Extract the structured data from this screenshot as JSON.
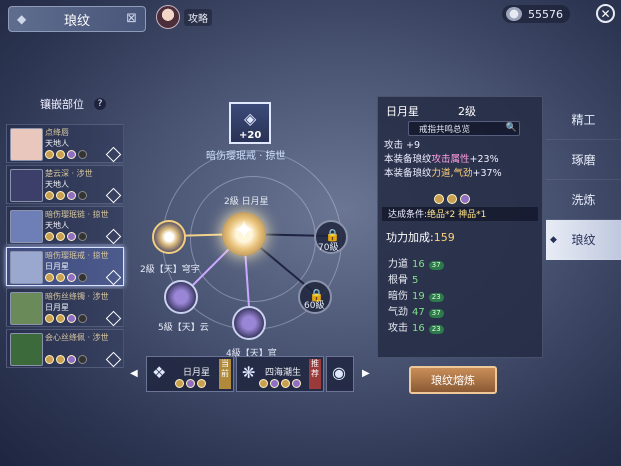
{
  "header": {
    "title": "琅纹",
    "guide_label": "攻略",
    "currency_value": "55576"
  },
  "left_panel": {
    "title": "镶嵌部位",
    "help": "?",
    "slots": [
      {
        "name": "点绛唇",
        "sub": "天地人",
        "thumb_color": "#e9c7bd",
        "selected": false
      },
      {
        "name": "楚云深 · 涉世",
        "sub": "天地人",
        "thumb_color": "#3b3f6a",
        "selected": false
      },
      {
        "name": "暗伤璎珉链 · 掠世",
        "sub": "天地人",
        "thumb_color": "#6e7fb8",
        "selected": false
      },
      {
        "name": "暗伤璎珉戒 · 掠世",
        "sub": "日月星",
        "thumb_color": "#9aa7cf",
        "selected": true
      },
      {
        "name": "暗伤丝绦镯 · 涉世",
        "sub": "日月星",
        "thumb_color": "#6a8a5a",
        "selected": false
      },
      {
        "name": "会心丝绦佩 · 涉世",
        "sub": "",
        "thumb_color": "#3d6a3a",
        "selected": false
      }
    ]
  },
  "wheel": {
    "top_gem_plus": "+20",
    "top_gem_name": "暗伤璎珉戒 · 掠世",
    "center_label": "2級 日月星",
    "nodes": [
      {
        "label": "2級【天】穹宇"
      },
      {
        "label": "5級【天】云"
      },
      {
        "label": "4級【天】官"
      },
      {
        "label": "70級"
      },
      {
        "label": "60級"
      }
    ]
  },
  "bottom_strip": {
    "cards": [
      {
        "name": "日月星",
        "tag": "当前"
      },
      {
        "name": "四海潮生",
        "tag": "推荐"
      }
    ]
  },
  "info": {
    "name": "日月星",
    "level": "2级",
    "set_button": "戒指共鸣总览",
    "stat_lines": [
      {
        "a": "攻击 +9",
        "b": "",
        "c": ""
      },
      {
        "a": "本装备琅纹",
        "b": "攻击属性",
        "c": "+23%"
      },
      {
        "a": "本装备琅纹",
        "b": "力道,气劲",
        "c": "+37%"
      }
    ],
    "condition_prefix": "达成条件:",
    "condition_value": "绝品*2 神品*1",
    "power_label": "功力加成:",
    "power_value": "159",
    "attrs": [
      {
        "name": "力道",
        "value": "16",
        "badge": "37"
      },
      {
        "name": "根骨",
        "value": "5",
        "badge": ""
      },
      {
        "name": "暗伤",
        "value": "19",
        "badge": "23"
      },
      {
        "name": "气劲",
        "value": "47",
        "badge": "37"
      },
      {
        "name": "攻击",
        "value": "16",
        "badge": "23"
      }
    ]
  },
  "forge_button": "琅纹熔炼",
  "tabs": [
    {
      "label": "精工",
      "active": false
    },
    {
      "label": "琢磨",
      "active": false
    },
    {
      "label": "洗炼",
      "active": false
    },
    {
      "label": "琅纹",
      "active": true
    }
  ]
}
